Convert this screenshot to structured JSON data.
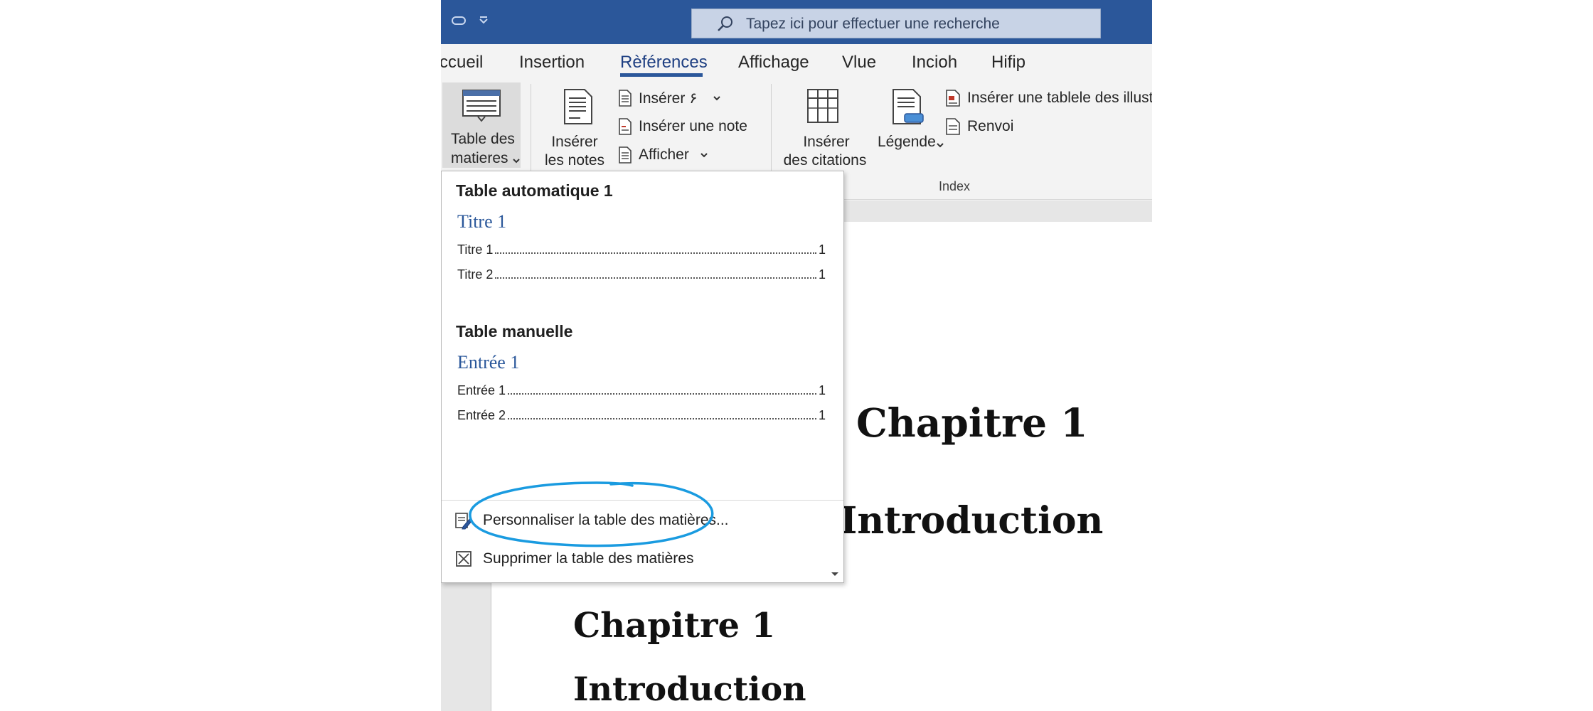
{
  "search": {
    "placeholder": "Tapez ici pour effectuer une recherche"
  },
  "tabs": [
    {
      "label": "ccueil"
    },
    {
      "label": "Insertion"
    },
    {
      "label": "Rèférences",
      "active": true
    },
    {
      "label": "Affichage"
    },
    {
      "label": "Vlue"
    },
    {
      "label": "Incioh"
    },
    {
      "label": "Hifip"
    }
  ],
  "ribbon": {
    "toc_button": {
      "line1": "Table des",
      "line2": "matieres"
    },
    "notes_button": {
      "line1": "Insérer",
      "line2": "les notes"
    },
    "notes_menu": {
      "insert_dropdown": "Insérer ۶",
      "insert_note": "Insérer une note",
      "show": "Afficher"
    },
    "citations_button": {
      "line1": "Insérer",
      "line2": "des citations"
    },
    "caption_button": {
      "label": "Légende"
    },
    "index_menu": {
      "insert_table": "Insérer une tablele des illustre",
      "cross_reference": "Renvoi"
    },
    "group_index": "Index"
  },
  "toc_dropdown": {
    "auto_table": {
      "heading": "Table automatique 1",
      "title": "Titre 1",
      "entries": [
        {
          "text": "Titre 1",
          "page": "1"
        },
        {
          "text": "Titre 2",
          "page": "1"
        }
      ]
    },
    "manual_table": {
      "heading": "Table manuelle",
      "title": "Entrée 1",
      "entries": [
        {
          "text": "Entrée 1",
          "page": "1"
        },
        {
          "text": "Entrée 2",
          "page": "1"
        }
      ]
    },
    "customize": "Personnaliser la table des matières...",
    "remove": "Supprimer la table des matières"
  },
  "document": {
    "headings": [
      {
        "text": "Chapitre 1"
      },
      {
        "text": "Introduction"
      },
      {
        "text": "Chapitre 1"
      },
      {
        "text": "Introduction"
      }
    ]
  },
  "colors": {
    "titlebar": "#2b579a",
    "accent_text": "#1e3f82",
    "highlight_ring": "#1a9be0"
  }
}
